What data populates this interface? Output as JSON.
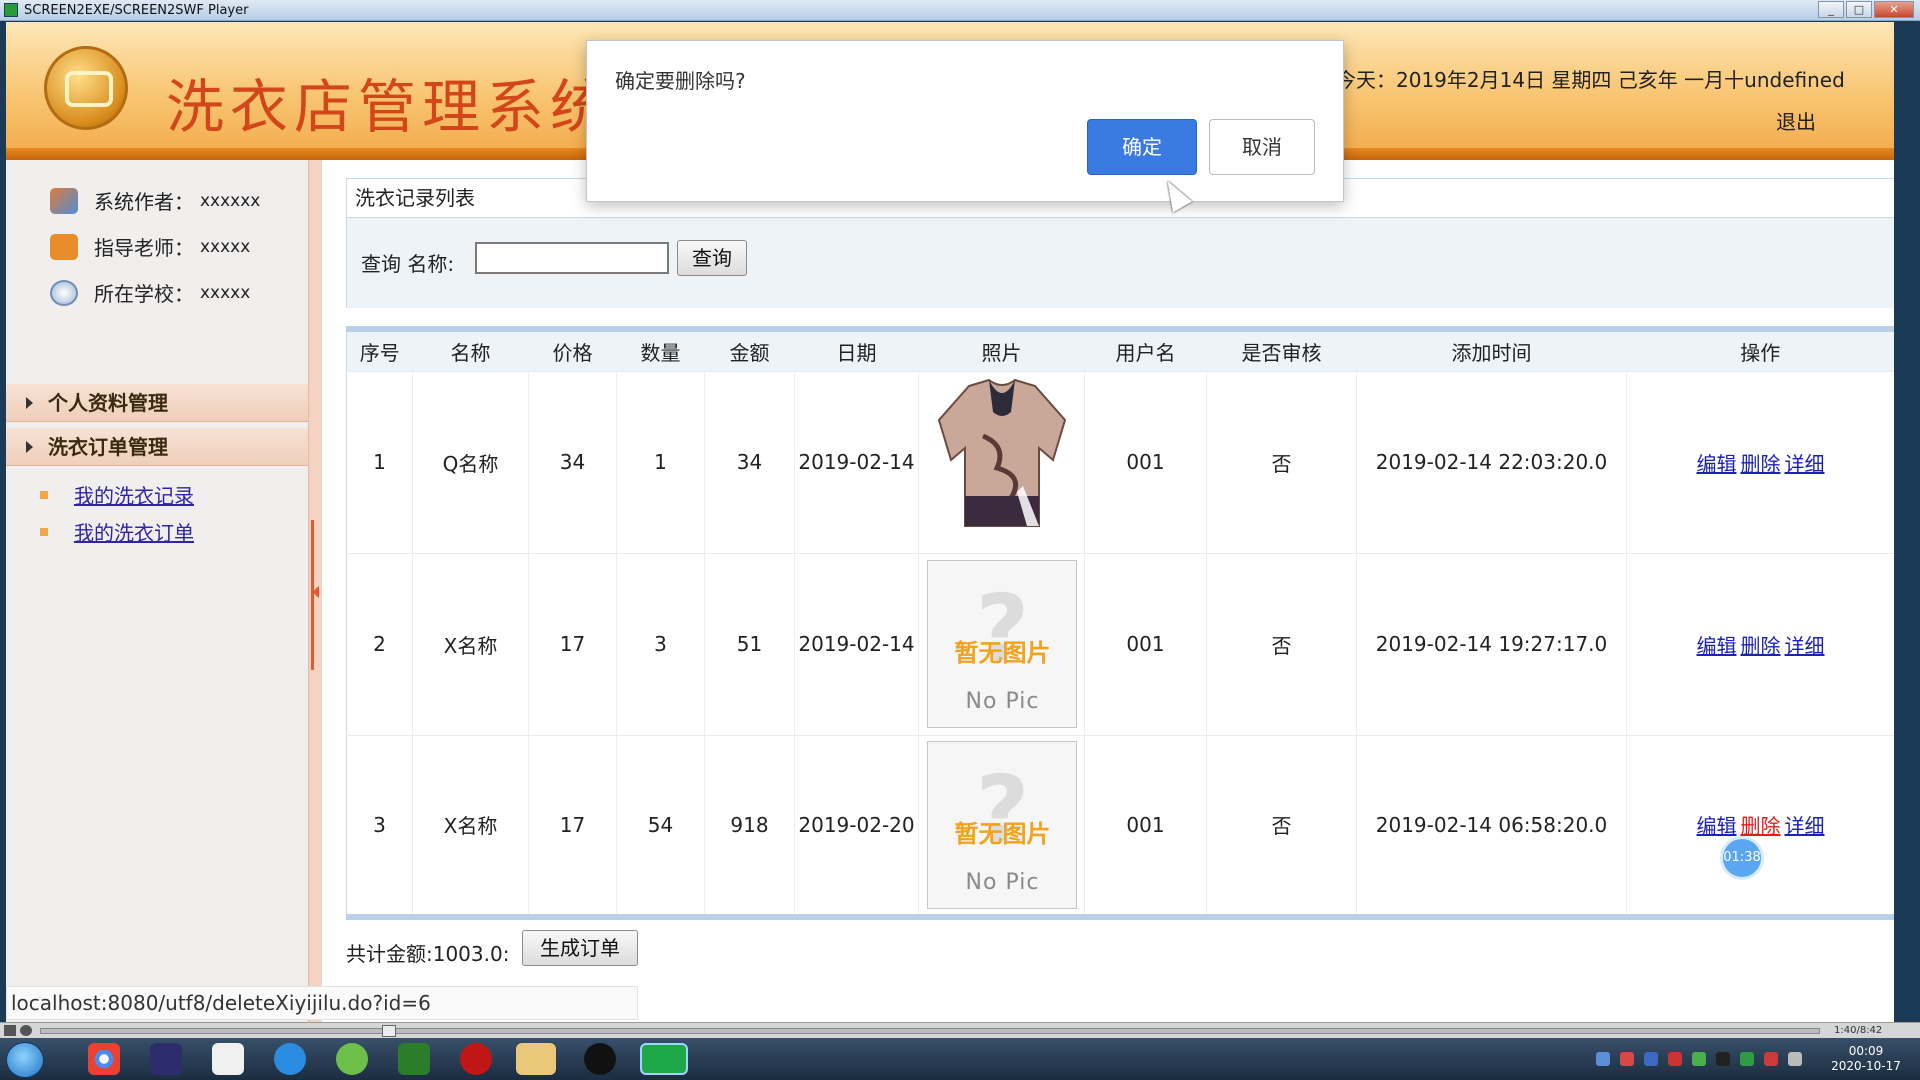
{
  "window": {
    "title": "SCREEN2EXE/SCREEN2SWF Player"
  },
  "header": {
    "system_title": "洗衣店管理系统",
    "today": "今天：2019年2月14日 星期四 己亥年 一月十undefined",
    "logout": "退出"
  },
  "sidebar": {
    "info": [
      {
        "label": "系统作者：",
        "value": "xxxxxx",
        "icon": "user-group-icon"
      },
      {
        "label": "指导老师：",
        "value": "xxxxx",
        "icon": "teacher-icon"
      },
      {
        "label": "所在学校：",
        "value": "xxxxx",
        "icon": "school-icon"
      }
    ],
    "menus": [
      {
        "title": "个人资料管理"
      },
      {
        "title": "洗衣订单管理",
        "items": [
          {
            "label": "我的洗衣记录"
          },
          {
            "label": "我的洗衣订单"
          }
        ]
      }
    ]
  },
  "panel": {
    "title": "洗衣记录列表"
  },
  "search": {
    "label": "查询 名称:",
    "value": "",
    "button": "查询"
  },
  "table": {
    "headers": [
      "序号",
      "名称",
      "价格",
      "数量",
      "金额",
      "日期",
      "照片",
      "用户名",
      "是否审核",
      "添加时间",
      "操作"
    ],
    "rows": [
      {
        "no": "1",
        "name": "Q名称",
        "price": "34",
        "qty": "1",
        "amount": "34",
        "date": "2019-02-14",
        "photo": "shirt",
        "user": "001",
        "audited": "否",
        "added": "2019-02-14 22:03:20.0"
      },
      {
        "no": "2",
        "name": "X名称",
        "price": "17",
        "qty": "3",
        "amount": "51",
        "date": "2019-02-14",
        "photo": "none",
        "user": "001",
        "audited": "否",
        "added": "2019-02-14 19:27:17.0"
      },
      {
        "no": "3",
        "name": "X名称",
        "price": "17",
        "qty": "54",
        "amount": "918",
        "date": "2019-02-20",
        "photo": "none",
        "user": "001",
        "audited": "否",
        "added": "2019-02-14 06:58:20.0"
      }
    ],
    "ops": {
      "edit": "编辑",
      "delete": "删除",
      "detail": "详细"
    },
    "nopic": {
      "zh": "暂无图片",
      "en": "No Pic",
      "mark": "?"
    }
  },
  "footer": {
    "total": "共计金额:1003.0:",
    "generate": "生成订单"
  },
  "overlay_timer": "01:38",
  "status_url": "localhost:8080/utf8/deleteXiyijilu.do?id=6",
  "dialog": {
    "message": "确定要删除吗?",
    "ok": "确定",
    "cancel": "取消"
  },
  "player": {
    "time": "1:40/8:42"
  },
  "taskbar": {
    "clock_time": "00:09",
    "clock_date": "2020-10-17"
  },
  "colors": {
    "header_orange": "#f3a94a",
    "title_red": "#d2461a",
    "link_blue": "#1b22b5",
    "delete_red": "#e21a1a",
    "ok_blue": "#3b7ae0"
  }
}
